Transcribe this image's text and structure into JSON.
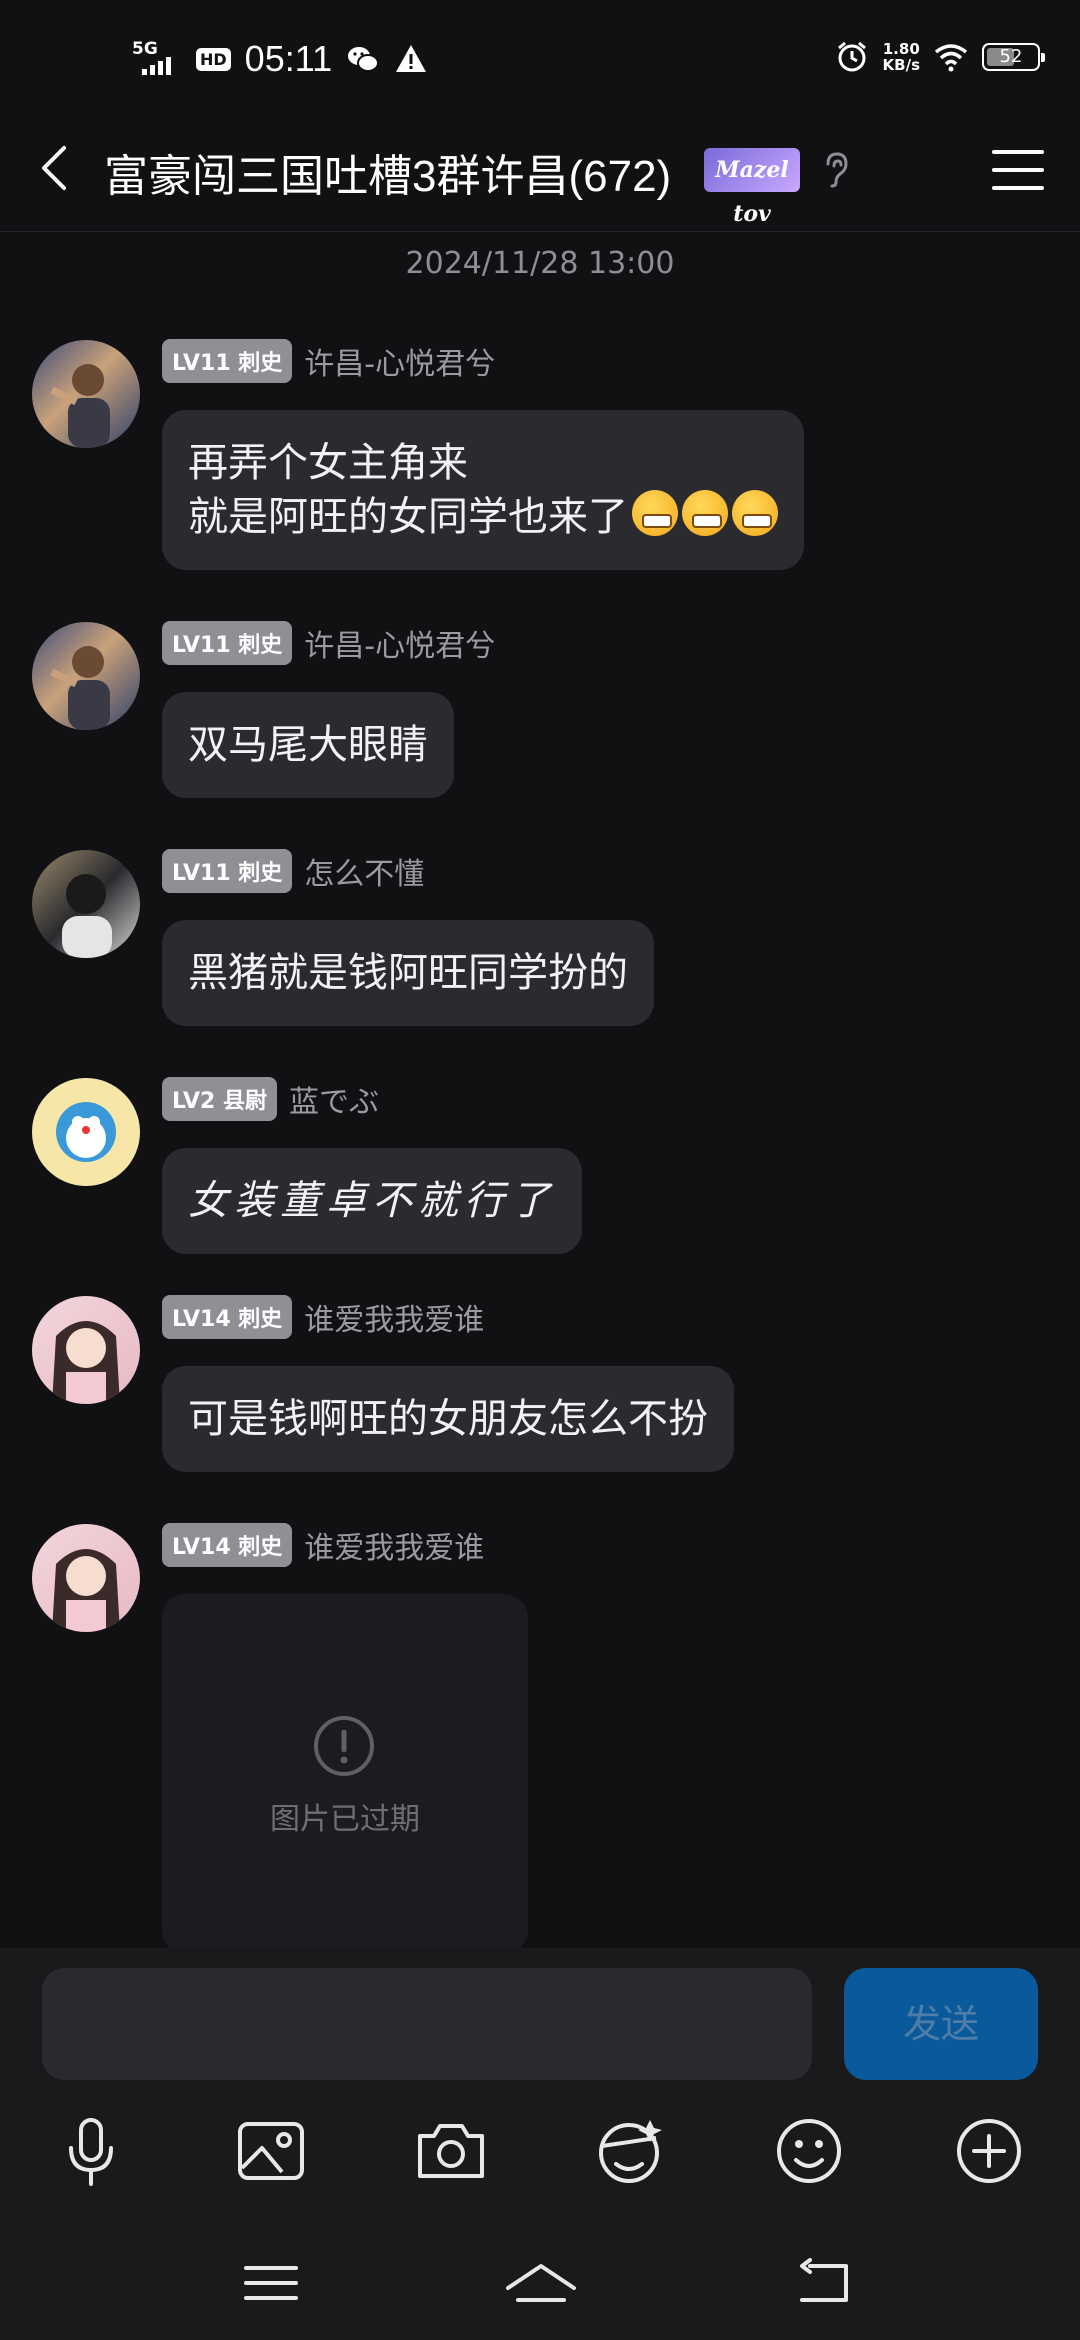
{
  "status_bar": {
    "network": "5G",
    "hd": "HD",
    "time": "05:11",
    "speed_value": "1.80",
    "speed_unit": "KB/s",
    "battery": "52"
  },
  "header": {
    "title": "富豪闯三国吐槽3群许昌(672)",
    "badge_text": "Mazel tov"
  },
  "timestamp": "2024/11/28 13:00",
  "messages": [
    {
      "level": "LV11 刺史",
      "nick": "许昌-心悦君兮",
      "text": "再弄个女主角来\n就是阿旺的女同学也来了",
      "emoji_count": 3
    },
    {
      "level": "LV11 刺史",
      "nick": "许昌-心悦君兮",
      "text": "双马尾大眼睛"
    },
    {
      "level": "LV11 刺史",
      "nick": "怎么不懂",
      "text": "黑猪就是钱阿旺同学扮的"
    },
    {
      "level": "LV2 县尉",
      "nick": "蓝でぶ",
      "text": "女装董卓不就行了"
    },
    {
      "level": "LV14 刺史",
      "nick": "谁爱我我爱谁",
      "text": "可是钱啊旺的女朋友怎么不扮"
    },
    {
      "level": "LV14 刺史",
      "nick": "谁爱我我爱谁",
      "image_status": "图片已过期"
    }
  ],
  "input": {
    "send_label": "发送"
  },
  "colors": {
    "background": "#111114",
    "bubble": "#2b2b2f",
    "send_button": "#0a5a9b"
  },
  "toolbar_icons": [
    "microphone-icon",
    "image-icon",
    "camera-icon",
    "sticker-icon",
    "emoji-icon",
    "plus-icon"
  ],
  "nav_icons": [
    "menu-icon",
    "home-icon",
    "back-icon"
  ]
}
